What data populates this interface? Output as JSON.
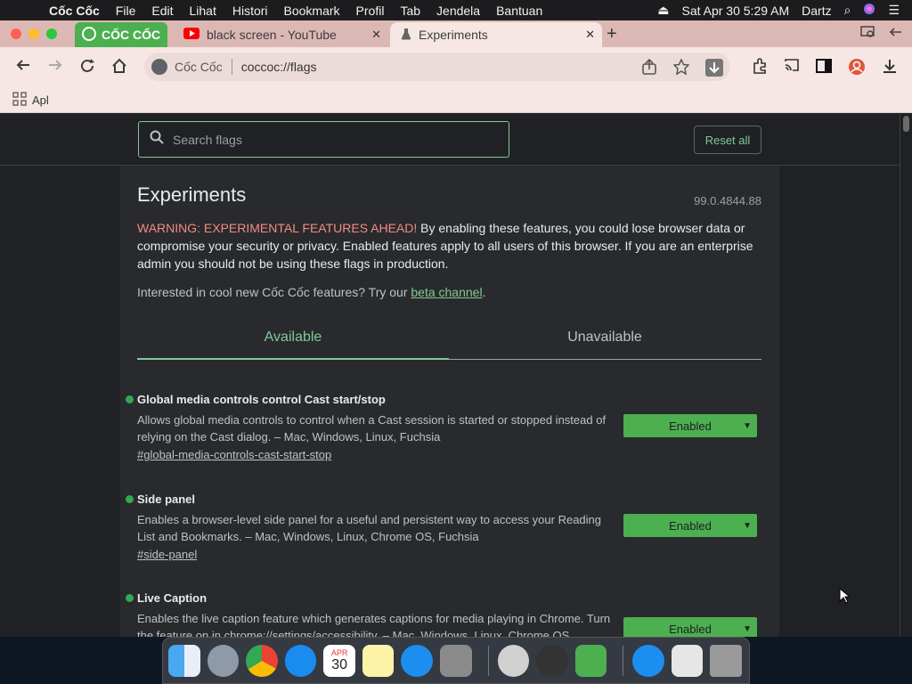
{
  "menubar": {
    "app_name": "Cốc Cốc",
    "items": [
      "File",
      "Edit",
      "Lihat",
      "Histori",
      "Bookmark",
      "Profil",
      "Tab",
      "Jendela",
      "Bantuan"
    ],
    "clock": "Sat Apr 30  5:29 AM",
    "user": "Dartz"
  },
  "tabs": {
    "brand_label": "CỐC CỐC",
    "youtube_title": "black screen - YouTube",
    "active_title": "Experiments"
  },
  "toolbar": {
    "site_label": "Cốc Cốc",
    "url": "coccoc://flags"
  },
  "bookmarks": {
    "apps_label": "Apl"
  },
  "search": {
    "placeholder": "Search flags",
    "reset_label": "Reset all"
  },
  "page": {
    "title": "Experiments",
    "version": "99.0.4844.88",
    "warning_strong": "WARNING: EXPERIMENTAL FEATURES AHEAD!",
    "warning_text": " By enabling these features, you could lose browser data or compromise your security or privacy. Enabled features apply to all users of this browser. If you are an enterprise admin you should not be using these flags in production.",
    "promo_text": "Interested in cool new Cốc Cốc features? Try our ",
    "promo_link": "beta channel",
    "promo_end": ".",
    "tab_available": "Available",
    "tab_unavailable": "Unavailable"
  },
  "flags": [
    {
      "name": "Global media controls control Cast start/stop",
      "desc": "Allows global media controls to control when a Cast session is started or stopped instead of relying on the Cast dialog. – Mac, Windows, Linux, Fuchsia",
      "link": "#global-media-controls-cast-start-stop",
      "state": "Enabled"
    },
    {
      "name": "Side panel",
      "desc": "Enables a browser-level side panel for a useful and persistent way to access your Reading List and Bookmarks. – Mac, Windows, Linux, Chrome OS, Fuchsia",
      "link": "#side-panel",
      "state": "Enabled"
    },
    {
      "name": "Live Caption",
      "desc": "Enables the live caption feature which generates captions for media playing in Chrome. Turn the feature on in chrome://settings/accessibility. – Mac, Windows, Linux, Chrome OS",
      "link": "",
      "state": "Enabled"
    }
  ],
  "dock": {
    "calendar_month": "APR",
    "calendar_day": "30"
  },
  "colors": {
    "accent": "#81c995",
    "select_bg": "#4caf50",
    "warning": "#f28b82",
    "tabstrip": "#dcb8b4"
  }
}
